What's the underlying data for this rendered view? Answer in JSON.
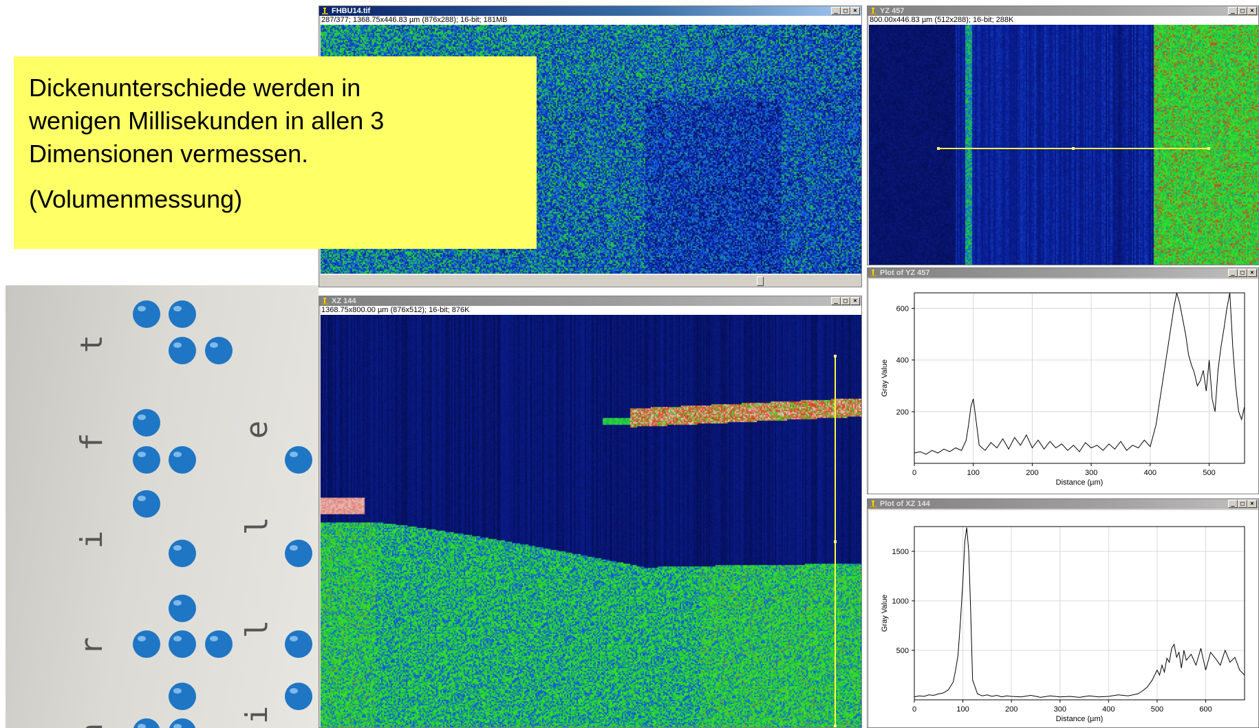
{
  "windows": {
    "main": {
      "title": "FHBU14.tif",
      "info": "287/377; 1368.75x446.83 µm (876x288); 16-bit; 181MB"
    },
    "yz": {
      "title": "YZ 457",
      "info": "800.00x446.83 µm (512x288); 16-bit; 288K"
    },
    "xz": {
      "title": "XZ 144",
      "info": "1368.75x800.00 µm (876x512); 16-bit; 876K"
    },
    "plot_yz": {
      "title": "Plot of YZ 457"
    },
    "plot_xz": {
      "title": "Plot of XZ 144"
    },
    "buttons": {
      "minimize": "_",
      "maximize": "□",
      "close": "×"
    }
  },
  "annotation": {
    "lines": [
      "Dickenunterschiede werden in",
      "wenigen Millisekunden in allen 3",
      "Dimensionen vermessen."
    ],
    "note": "(Volumenmessung)"
  },
  "braille_letters": [
    "t",
    "f",
    "i",
    "r",
    "h",
    "e",
    "l",
    "l",
    "i"
  ],
  "chart_data": [
    {
      "type": "line",
      "title": "Plot of YZ 457",
      "xlabel": "Distance (µm)",
      "ylabel": "Gray Value",
      "xlim": [
        0,
        560
      ],
      "ylim": [
        0,
        660
      ],
      "xticks": [
        0,
        100,
        200,
        300,
        400,
        500
      ],
      "yticks": [
        200,
        400,
        600
      ],
      "grid": true,
      "series": [
        {
          "x": [
            0,
            10,
            20,
            30,
            40,
            50,
            60,
            70,
            80,
            88,
            92,
            96,
            100,
            104,
            110,
            120,
            130,
            140,
            150,
            160,
            170,
            180,
            190,
            200,
            210,
            220,
            230,
            240,
            250,
            260,
            270,
            280,
            290,
            300,
            310,
            320,
            330,
            340,
            350,
            360,
            370,
            380,
            390,
            400,
            410,
            420,
            430,
            440,
            445,
            450,
            455,
            460,
            465,
            470,
            475,
            480,
            485,
            490,
            495,
            500,
            505,
            510,
            515,
            520,
            525,
            530,
            535,
            540,
            545,
            550,
            555,
            560
          ],
          "y": [
            40,
            45,
            35,
            50,
            40,
            55,
            45,
            60,
            50,
            90,
            150,
            220,
            250,
            180,
            70,
            50,
            80,
            60,
            95,
            55,
            100,
            70,
            110,
            60,
            90,
            55,
            85,
            60,
            75,
            50,
            70,
            45,
            80,
            60,
            70,
            50,
            75,
            55,
            85,
            50,
            70,
            60,
            90,
            65,
            150,
            300,
            450,
            600,
            660,
            620,
            560,
            500,
            420,
            380,
            350,
            300,
            320,
            360,
            280,
            400,
            250,
            200,
            360,
            450,
            520,
            600,
            660,
            450,
            300,
            200,
            170,
            220
          ]
        }
      ]
    },
    {
      "type": "line",
      "title": "Plot of XZ 144",
      "xlabel": "Distance (µm)",
      "ylabel": "Gray Value",
      "xlim": [
        0,
        680
      ],
      "ylim": [
        0,
        1750
      ],
      "xticks": [
        0,
        100,
        200,
        300,
        400,
        500,
        600
      ],
      "yticks": [
        500,
        1000,
        1500
      ],
      "grid": true,
      "series": [
        {
          "x": [
            0,
            10,
            20,
            30,
            40,
            50,
            60,
            70,
            80,
            85,
            90,
            95,
            100,
            104,
            108,
            112,
            116,
            120,
            130,
            140,
            150,
            160,
            170,
            180,
            190,
            200,
            220,
            240,
            260,
            280,
            300,
            320,
            340,
            360,
            380,
            400,
            420,
            440,
            460,
            470,
            480,
            490,
            500,
            505,
            510,
            515,
            520,
            525,
            530,
            535,
            540,
            545,
            550,
            555,
            560,
            570,
            580,
            590,
            600,
            610,
            620,
            630,
            640,
            650,
            660,
            670,
            680
          ],
          "y": [
            30,
            40,
            35,
            50,
            45,
            60,
            70,
            100,
            180,
            300,
            450,
            800,
            1200,
            1600,
            1740,
            1500,
            900,
            200,
            60,
            40,
            50,
            35,
            45,
            30,
            40,
            35,
            30,
            45,
            25,
            40,
            30,
            35,
            25,
            40,
            30,
            35,
            50,
            40,
            60,
            90,
            130,
            200,
            300,
            250,
            350,
            280,
            420,
            380,
            520,
            560,
            430,
            480,
            320,
            500,
            400,
            460,
            350,
            520,
            300,
            480,
            420,
            350,
            500,
            380,
            430,
            300,
            250
          ]
        }
      ]
    }
  ],
  "colors": {
    "annotation_bg": "#ffff66",
    "dot_blue": "#1e76c4",
    "title_active": "#0a246a",
    "background_dark": "#050a3c"
  }
}
